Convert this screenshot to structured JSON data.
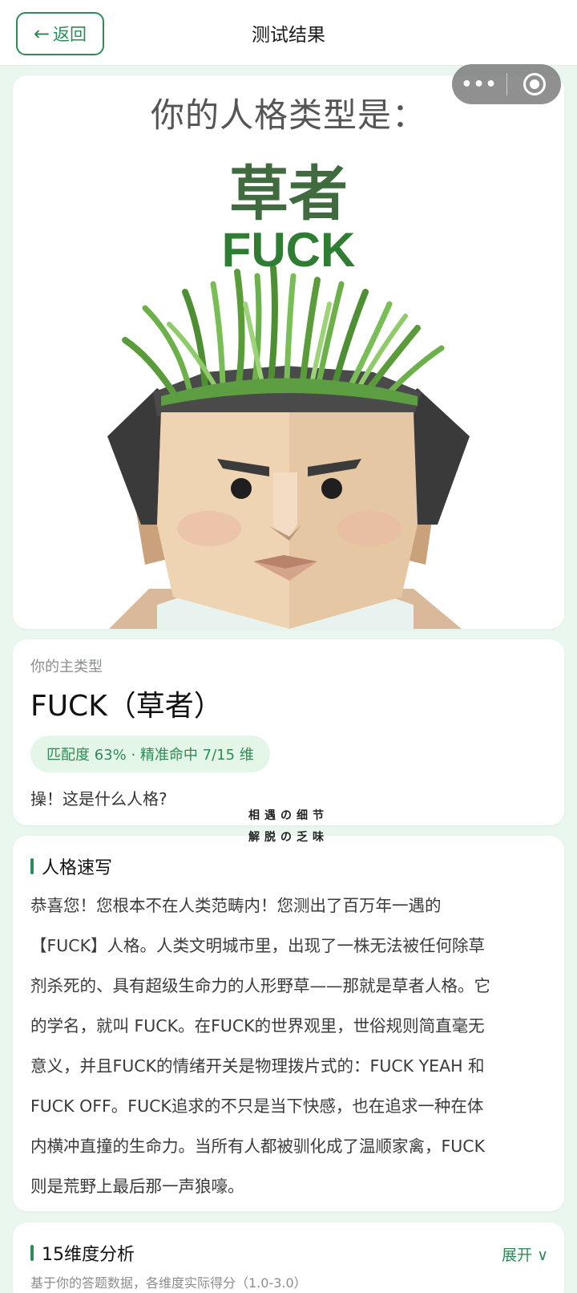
{
  "header": {
    "back_label": "返回",
    "title": "测试结果"
  },
  "result_image": {
    "line1": "你的人格类型是：",
    "line2": "草者",
    "line3": "FUCK"
  },
  "main_type": {
    "label": "你的主类型",
    "name": "FUCK（草者）",
    "badge": "匹配度 63% · 精准命中 7/15 维",
    "desc": "操！这是什么人格?"
  },
  "watermark": {
    "line1": "相遇の细节",
    "line2": "解脱の乏味"
  },
  "sketch": {
    "title": "人格速写",
    "lines": [
      "恭喜您！您根本不在人类范畴内！您测出了百万年一遇的",
      "【FUCK】人格。人类文明城市里，出现了一株无法被任何除草",
      "剂杀死的、具有超级生命力的人形野草——那就是草者人格。它",
      "的学名，就叫 FUCK。在FUCK的世界观里，世俗规则简直毫无",
      "意义，并且FUCK的情绪开关是物理拨片式的：FUCK YEAH 和",
      "FUCK OFF。FUCK追求的不只是当下快感，也在追求一种在体",
      "内横冲直撞的生命力。当所有人都被驯化成了温顺家禽，FUCK",
      "则是荒野上最后那一声狼嚎。"
    ]
  },
  "dimensions": {
    "title": "15维度分析",
    "expand_label": "展开 ∨",
    "subtitle": "基于你的答题数据，各维度实际得分（1.0-3.0）"
  }
}
